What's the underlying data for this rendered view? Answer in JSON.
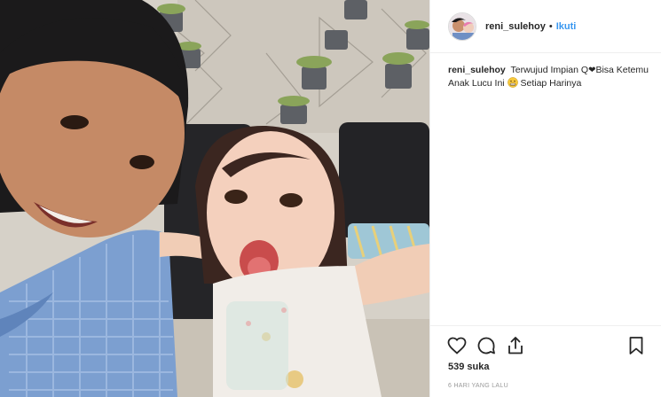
{
  "post": {
    "username": "reni_sulehoy",
    "separator": "•",
    "follow_label": "Ikuti",
    "caption": {
      "username": "reni_sulehoy",
      "text_part1": "Terwujud Impian Q",
      "heart": "❤",
      "text_part2": "Bisa Ketemu Anak Lucu Ini",
      "face_emoji_name": "grimacing-face-icon",
      "text_part3": "Setiap Harinya"
    },
    "likes": "539 suka",
    "timestamp": "6 HARI YANG LALU"
  },
  "colors": {
    "follow": "#3897f0",
    "text": "#262626",
    "meta": "#999999",
    "divider": "#efefef"
  },
  "icons": {
    "like": "heart-outline-icon",
    "comment": "comment-bubble-icon",
    "share": "share-icon",
    "save": "bookmark-icon"
  }
}
